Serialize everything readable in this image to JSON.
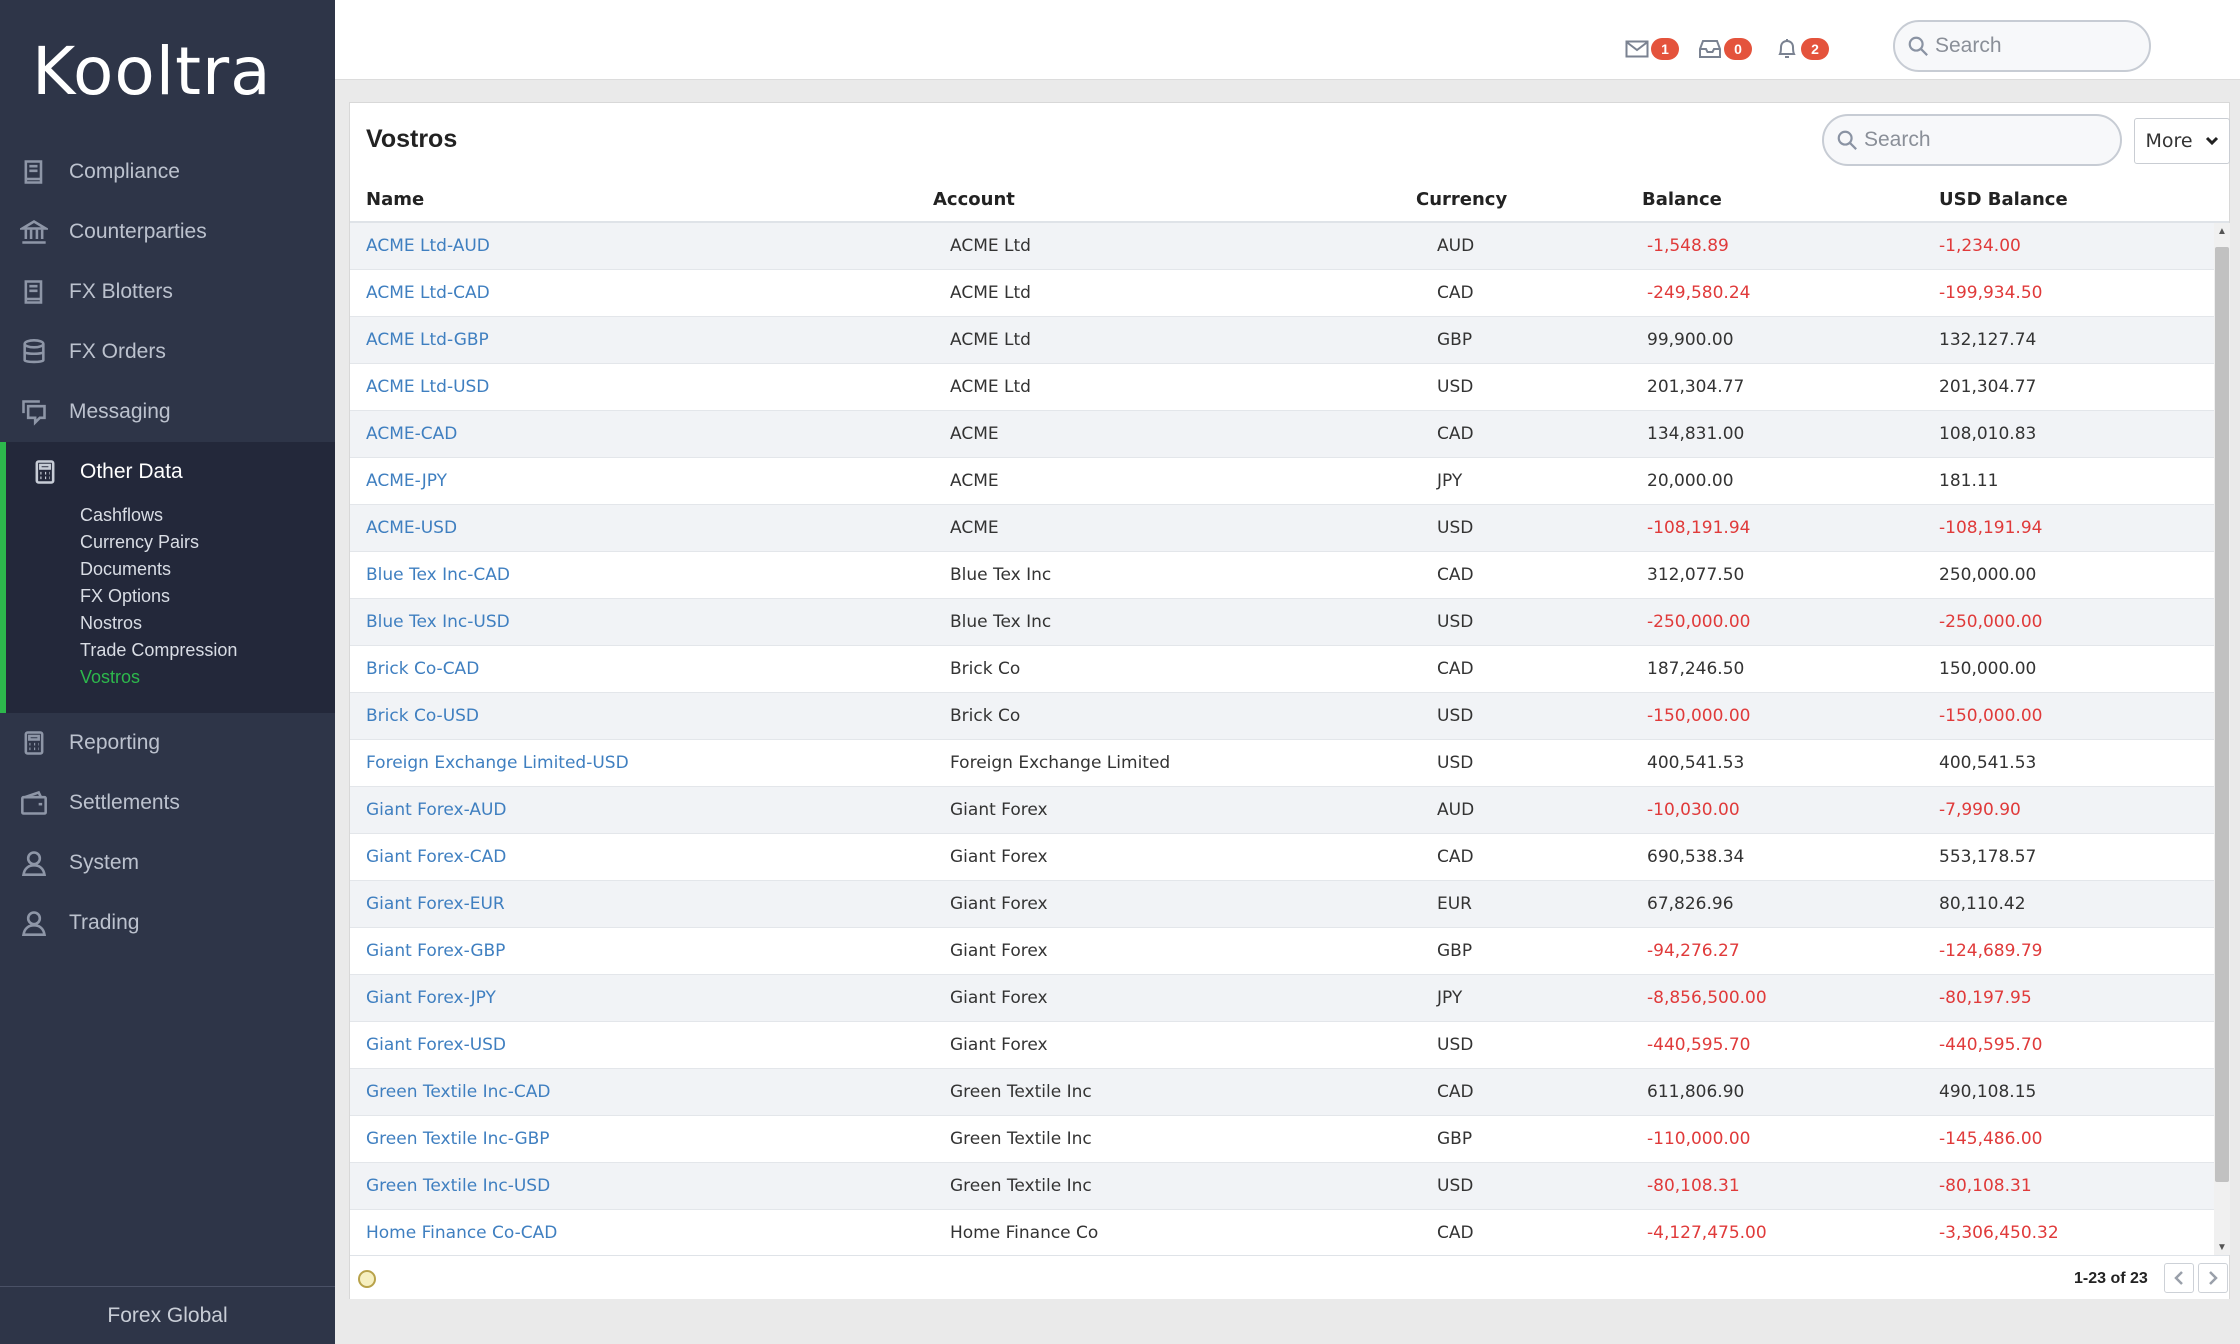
{
  "app": {
    "logo": "Kooltra",
    "footer": "Forex Global"
  },
  "sidebar": {
    "items_top": [
      {
        "label": "Compliance",
        "icon": "book-icon"
      },
      {
        "label": "Counterparties",
        "icon": "bank-icon"
      },
      {
        "label": "FX Blotters",
        "icon": "book-icon"
      },
      {
        "label": "FX Orders",
        "icon": "database-icon"
      },
      {
        "label": "Messaging",
        "icon": "chat-icon"
      }
    ],
    "group": {
      "label": "Other Data",
      "icon": "calculator-icon",
      "sub_items": [
        "Cashflows",
        "Currency Pairs",
        "Documents",
        "FX Options",
        "Nostros",
        "Trade Compression",
        "Vostros"
      ],
      "active": "Vostros"
    },
    "items_bottom": [
      {
        "label": "Reporting",
        "icon": "calculator-icon"
      },
      {
        "label": "Settlements",
        "icon": "wallet-icon"
      },
      {
        "label": "System",
        "icon": "user-icon"
      },
      {
        "label": "Trading",
        "icon": "user-icon"
      }
    ]
  },
  "topbar": {
    "mail_count": "1",
    "inbox_count": "0",
    "bell_count": "2",
    "search_placeholder": "Search"
  },
  "panel": {
    "title": "Vostros",
    "search_placeholder": "Search",
    "more_label": "More",
    "columns": {
      "name": "Name",
      "account": "Account",
      "currency": "Currency",
      "balance": "Balance",
      "usd_balance": "USD Balance"
    },
    "rows": [
      {
        "name": "ACME Ltd-AUD",
        "account": "ACME Ltd",
        "currency": "AUD",
        "balance": "-1,548.89",
        "usd_balance": "-1,234.00"
      },
      {
        "name": "ACME Ltd-CAD",
        "account": "ACME Ltd",
        "currency": "CAD",
        "balance": "-249,580.24",
        "usd_balance": "-199,934.50"
      },
      {
        "name": "ACME Ltd-GBP",
        "account": "ACME Ltd",
        "currency": "GBP",
        "balance": "99,900.00",
        "usd_balance": "132,127.74"
      },
      {
        "name": "ACME Ltd-USD",
        "account": "ACME Ltd",
        "currency": "USD",
        "balance": "201,304.77",
        "usd_balance": "201,304.77"
      },
      {
        "name": "ACME-CAD",
        "account": "ACME",
        "currency": "CAD",
        "balance": "134,831.00",
        "usd_balance": "108,010.83"
      },
      {
        "name": "ACME-JPY",
        "account": "ACME",
        "currency": "JPY",
        "balance": "20,000.00",
        "usd_balance": "181.11"
      },
      {
        "name": "ACME-USD",
        "account": "ACME",
        "currency": "USD",
        "balance": "-108,191.94",
        "usd_balance": "-108,191.94"
      },
      {
        "name": "Blue Tex Inc-CAD",
        "account": "Blue Tex Inc",
        "currency": "CAD",
        "balance": "312,077.50",
        "usd_balance": "250,000.00"
      },
      {
        "name": "Blue Tex Inc-USD",
        "account": "Blue Tex Inc",
        "currency": "USD",
        "balance": "-250,000.00",
        "usd_balance": "-250,000.00"
      },
      {
        "name": "Brick Co-CAD",
        "account": "Brick Co",
        "currency": "CAD",
        "balance": "187,246.50",
        "usd_balance": "150,000.00"
      },
      {
        "name": "Brick Co-USD",
        "account": "Brick Co",
        "currency": "USD",
        "balance": "-150,000.00",
        "usd_balance": "-150,000.00"
      },
      {
        "name": "Foreign Exchange Limited-USD",
        "account": "Foreign Exchange Limited",
        "currency": "USD",
        "balance": "400,541.53",
        "usd_balance": "400,541.53"
      },
      {
        "name": "Giant Forex-AUD",
        "account": "Giant Forex",
        "currency": "AUD",
        "balance": "-10,030.00",
        "usd_balance": "-7,990.90"
      },
      {
        "name": "Giant Forex-CAD",
        "account": "Giant Forex",
        "currency": "CAD",
        "balance": "690,538.34",
        "usd_balance": "553,178.57"
      },
      {
        "name": "Giant Forex-EUR",
        "account": "Giant Forex",
        "currency": "EUR",
        "balance": "67,826.96",
        "usd_balance": "80,110.42"
      },
      {
        "name": "Giant Forex-GBP",
        "account": "Giant Forex",
        "currency": "GBP",
        "balance": "-94,276.27",
        "usd_balance": "-124,689.79"
      },
      {
        "name": "Giant Forex-JPY",
        "account": "Giant Forex",
        "currency": "JPY",
        "balance": "-8,856,500.00",
        "usd_balance": "-80,197.95"
      },
      {
        "name": "Giant Forex-USD",
        "account": "Giant Forex",
        "currency": "USD",
        "balance": "-440,595.70",
        "usd_balance": "-440,595.70"
      },
      {
        "name": "Green Textile Inc-CAD",
        "account": "Green Textile Inc",
        "currency": "CAD",
        "balance": "611,806.90",
        "usd_balance": "490,108.15"
      },
      {
        "name": "Green Textile Inc-GBP",
        "account": "Green Textile Inc",
        "currency": "GBP",
        "balance": "-110,000.00",
        "usd_balance": "-145,486.00"
      },
      {
        "name": "Green Textile Inc-USD",
        "account": "Green Textile Inc",
        "currency": "USD",
        "balance": "-80,108.31",
        "usd_balance": "-80,108.31"
      },
      {
        "name": "Home Finance Co-CAD",
        "account": "Home Finance Co",
        "currency": "CAD",
        "balance": "-4,127,475.00",
        "usd_balance": "-3,306,450.32"
      }
    ],
    "pager": "1-23 of 23"
  },
  "colors": {
    "sidebar_bg": "#2e3548",
    "accent_green": "#2db84c",
    "link_blue": "#3f7fc0",
    "negative_red": "#e03a3a",
    "badge_red": "#e4533c"
  }
}
